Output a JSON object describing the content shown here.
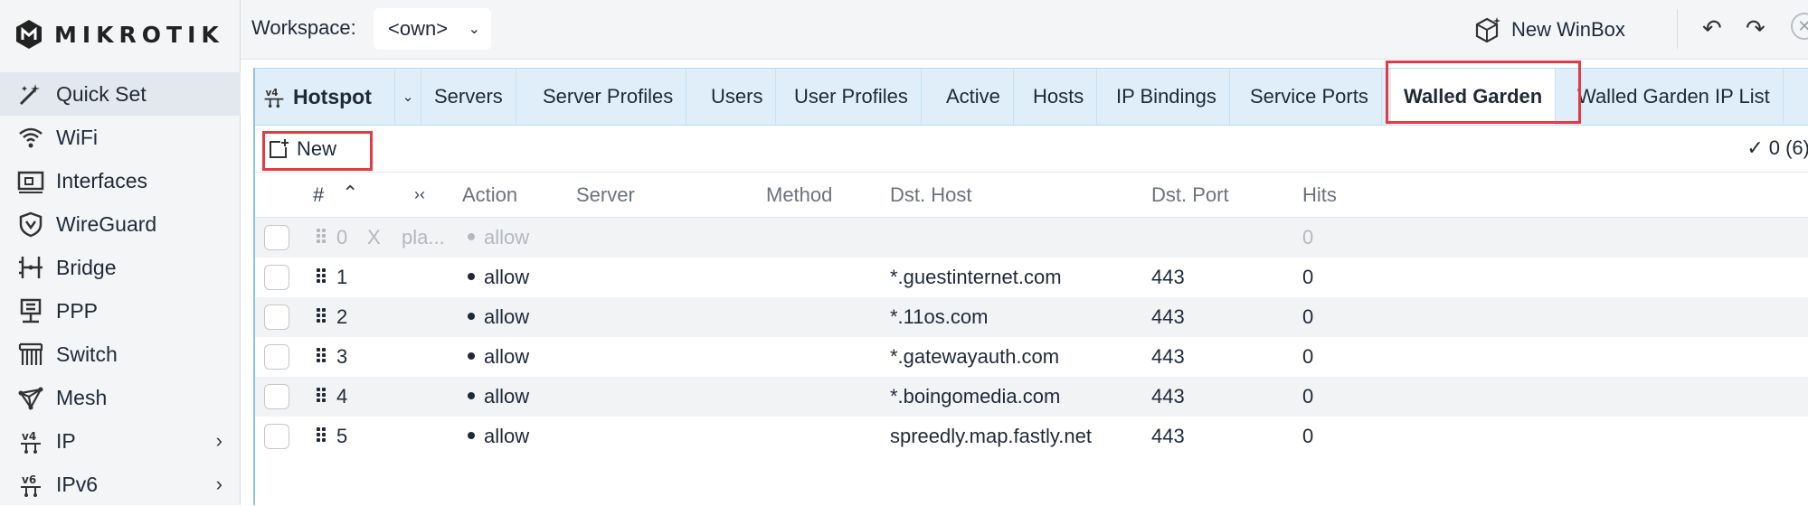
{
  "brand": {
    "logo_text": "MikroTik"
  },
  "sidebar": {
    "items": [
      {
        "label": "Quick Set",
        "icon": "quick-set-icon",
        "active": true
      },
      {
        "label": "WiFi",
        "icon": "wifi-icon"
      },
      {
        "label": "Interfaces",
        "icon": "interfaces-icon"
      },
      {
        "label": "WireGuard",
        "icon": "wireguard-icon"
      },
      {
        "label": "Bridge",
        "icon": "bridge-icon"
      },
      {
        "label": "PPP",
        "icon": "ppp-icon"
      },
      {
        "label": "Switch",
        "icon": "switch-icon"
      },
      {
        "label": "Mesh",
        "icon": "mesh-icon"
      },
      {
        "label": "IP",
        "icon": "ip-icon",
        "has_submenu": true
      },
      {
        "label": "IPv6",
        "icon": "ipv6-icon",
        "has_submenu": true
      }
    ]
  },
  "topbar": {
    "workspace_label": "Workspace:",
    "workspace_value": "<own>",
    "new_winbox": "New WinBox"
  },
  "window": {
    "title": "Hotspot",
    "tabs": [
      "Servers",
      "Server Profiles",
      "Users",
      "User Profiles",
      "Active",
      "Hosts",
      "IP Bindings",
      "Service Ports",
      "Walled Garden",
      "Walled Garden IP List"
    ],
    "selected_tab": "Walled Garden",
    "toolbar": {
      "new_label": "New",
      "count": "0 (6)"
    },
    "table": {
      "columns": {
        "num": "#",
        "action": "Action",
        "server": "Server",
        "method": "Method",
        "dst_host": "Dst. Host",
        "dst_port": "Dst. Port",
        "hits": "Hits"
      },
      "rows": [
        {
          "num": "0",
          "flag": "X",
          "comment": "pla...",
          "action": "allow",
          "server": "",
          "method": "",
          "dst_host": "",
          "dst_port": "",
          "hits": "0",
          "disabled": true
        },
        {
          "num": "1",
          "flag": "",
          "comment": "",
          "action": "allow",
          "server": "",
          "method": "",
          "dst_host": "*.guestinternet.com",
          "dst_port": "443",
          "hits": "0"
        },
        {
          "num": "2",
          "flag": "",
          "comment": "",
          "action": "allow",
          "server": "",
          "method": "",
          "dst_host": "*.11os.com",
          "dst_port": "443",
          "hits": "0"
        },
        {
          "num": "3",
          "flag": "",
          "comment": "",
          "action": "allow",
          "server": "",
          "method": "",
          "dst_host": "*.gatewayauth.com",
          "dst_port": "443",
          "hits": "0"
        },
        {
          "num": "4",
          "flag": "",
          "comment": "",
          "action": "allow",
          "server": "",
          "method": "",
          "dst_host": "*.boingomedia.com",
          "dst_port": "443",
          "hits": "0"
        },
        {
          "num": "5",
          "flag": "",
          "comment": "",
          "action": "allow",
          "server": "",
          "method": "",
          "dst_host": "spreedly.map.fastly.net",
          "dst_port": "443",
          "hits": "0"
        }
      ]
    }
  },
  "colors": {
    "highlight": "#e23b45",
    "tabbar": "#dfeef9",
    "sidebar": "#f3f5f7",
    "panel_border": "#8fc3e8"
  }
}
